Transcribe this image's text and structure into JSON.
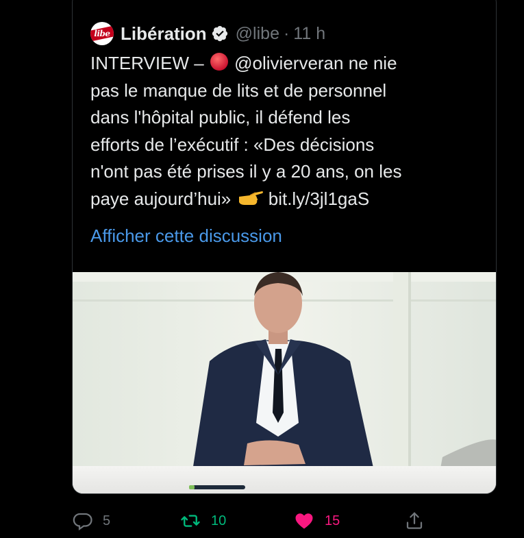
{
  "tweet": {
    "author_name": "Libération",
    "handle": "@libe",
    "separator": "·",
    "time": "11 h",
    "avatar_text": "libe",
    "text_line1_prefix": "INTERVIEW –",
    "text_line1_suffix": "@olivierveran ne nie",
    "text_line2": "pas le manque de lits et de personnel",
    "text_line3": "dans l'hôpital public, il défend les",
    "text_line4": "efforts de l’exécutif : «Des décisions",
    "text_line5": "n'ont pas été prises il y a 20 ans, on les",
    "text_line6_prefix": "paye aujourd’hui»",
    "text_line6_link": "bit.ly/3jl1gaS",
    "show_thread": "Afficher cette discussion"
  },
  "actions": {
    "reply_count": "5",
    "retweet_count": "10",
    "like_count": "15"
  },
  "colors": {
    "background": "#000000",
    "text": "#e7e9ea",
    "muted": "#71767b",
    "link": "#4a99e9",
    "retweet": "#00ba7c",
    "like": "#f91880",
    "brand_red": "#c3001b"
  }
}
